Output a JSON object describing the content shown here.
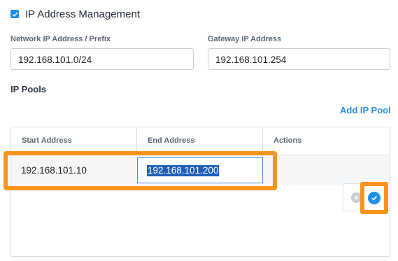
{
  "ipam": {
    "checkbox_label": "IP Address Management",
    "checked": true
  },
  "network": {
    "label": "Network IP Address / Prefix",
    "value": "192.168.101.0/24"
  },
  "gateway": {
    "label": "Gateway IP Address",
    "value": "192.168.101.254"
  },
  "pools": {
    "title": "IP Pools",
    "add_label": "Add IP Pool",
    "columns": [
      "Start Address",
      "End Address",
      "Actions"
    ],
    "editing_row": {
      "start": "192.168.101.10",
      "end": "192.168.101.200"
    }
  },
  "colors": {
    "accent": "#2a8ce0",
    "highlight": "#f7941d",
    "selection": "#1f5fb8"
  },
  "icons": {
    "checkbox": "check-icon",
    "cancel": "close-icon",
    "confirm": "check-circle-icon"
  }
}
